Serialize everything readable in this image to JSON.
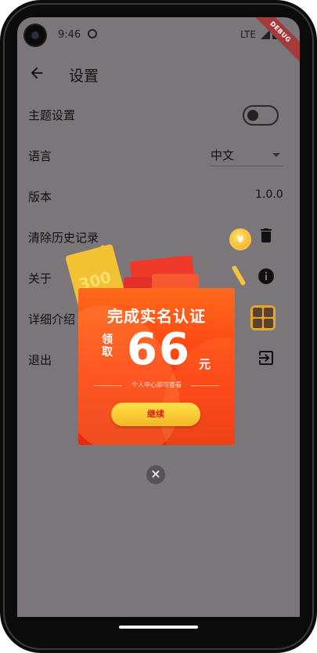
{
  "status_bar": {
    "time": "9:46",
    "network": "LTE",
    "debug_banner": "DEBUG"
  },
  "app_bar": {
    "back_icon": "arrow-left-icon",
    "title": "设置"
  },
  "settings": {
    "theme": {
      "label": "主题设置",
      "toggle_on": false
    },
    "language": {
      "label": "语言",
      "value": "中文"
    },
    "version": {
      "label": "版本",
      "value": "1.0.0"
    },
    "clear_history": {
      "label": "清除历史记录",
      "icon": "trash-icon"
    },
    "about": {
      "label": "关于",
      "icon": "info-icon"
    },
    "details": {
      "label": "详细介绍",
      "icon": "calculator-icon"
    },
    "logout": {
      "label": "退出",
      "icon": "logout-icon"
    }
  },
  "promo": {
    "ticket_text": "300",
    "coin_symbol": "¥",
    "title": "完成实名认证",
    "receive_label": "领取",
    "amount": "66",
    "unit": "元",
    "note": "个人中心即可查看",
    "button": "继续"
  },
  "close_icon": "close-icon",
  "colors": {
    "overlay": "#7b7679",
    "promo": "#ff4a18",
    "button": "#f7c532"
  }
}
